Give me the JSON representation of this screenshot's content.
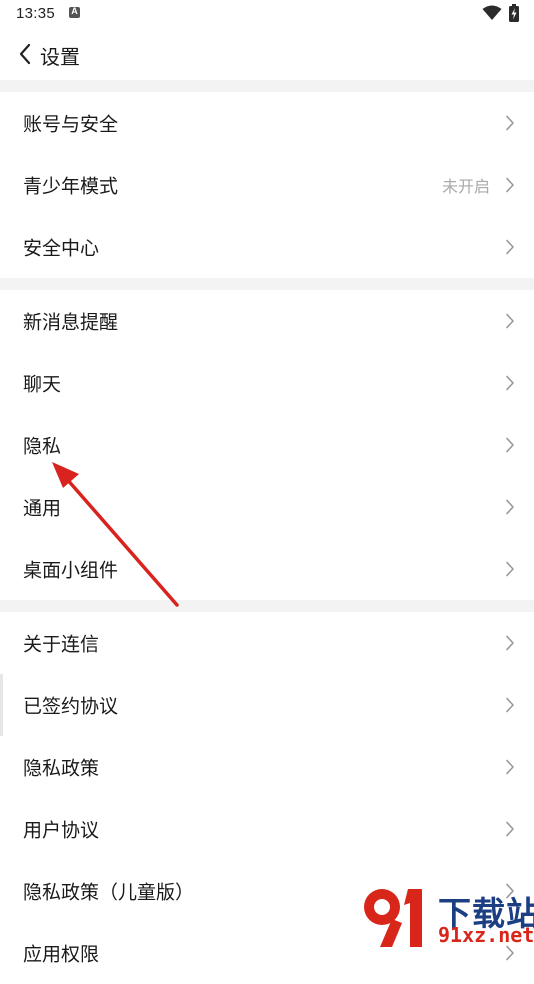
{
  "status_bar": {
    "time": "13:35",
    "notification_icon_letter": "A"
  },
  "header": {
    "title": "设置"
  },
  "groups": [
    {
      "items": [
        {
          "label": "账号与安全"
        },
        {
          "label": "青少年模式",
          "value": "未开启"
        },
        {
          "label": "安全中心"
        }
      ]
    },
    {
      "items": [
        {
          "label": "新消息提醒"
        },
        {
          "label": "聊天"
        },
        {
          "label": "隐私"
        },
        {
          "label": "通用"
        },
        {
          "label": "桌面小组件"
        }
      ]
    },
    {
      "items": [
        {
          "label": "关于连信"
        },
        {
          "label": "已签约协议"
        },
        {
          "label": "隐私政策"
        },
        {
          "label": "用户协议"
        },
        {
          "label": "隐私政策（儿童版）"
        },
        {
          "label": "应用权限"
        }
      ]
    }
  ],
  "watermark": {
    "title": "下载站",
    "domain": "91xz.net"
  },
  "colors": {
    "background": "#ffffff",
    "separator": "#f3f3f3",
    "text_primary": "#1a1a1a",
    "text_secondary": "#aaaaaa",
    "chevron": "#9a9a9a",
    "annotation_arrow": "#d8231e",
    "watermark_blue": "#1c3f84",
    "watermark_red": "#d8261b"
  }
}
